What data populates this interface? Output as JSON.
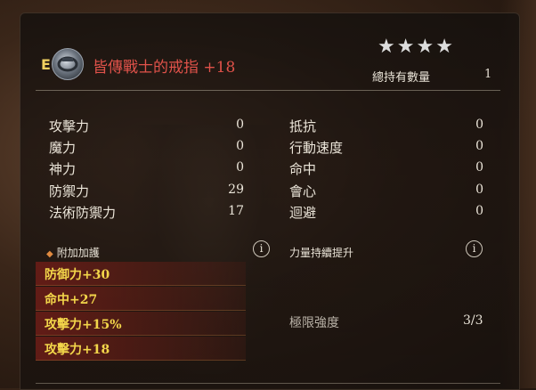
{
  "item": {
    "grade": "E",
    "name": "皆傳戰士的戒指 +18",
    "stars": [
      "★",
      "★",
      "★",
      "★"
    ],
    "owned_label": "總持有數量",
    "owned_value": "1"
  },
  "stats_left": [
    {
      "label": "攻擊力",
      "value": "0"
    },
    {
      "label": "魔力",
      "value": "0"
    },
    {
      "label": "神力",
      "value": "0"
    },
    {
      "label": "防禦力",
      "value": "29"
    },
    {
      "label": "法術防禦力",
      "value": "17"
    }
  ],
  "stats_right": [
    {
      "label": "抵抗",
      "value": "0"
    },
    {
      "label": "行動速度",
      "value": "0"
    },
    {
      "label": "命中",
      "value": "0"
    },
    {
      "label": "會心",
      "value": "0"
    },
    {
      "label": "迴避",
      "value": "0"
    }
  ],
  "bonus_section": {
    "diamond": "◆",
    "title": "附加加護",
    "info_symbol": "i",
    "items": [
      "防御力+30",
      "命中+27",
      "攻擊力+15%",
      "攻擊力+18"
    ]
  },
  "power_section": {
    "title": "力量持續提升",
    "info_symbol": "i",
    "limit_label": "極限強度",
    "limit_value": "3/3"
  }
}
